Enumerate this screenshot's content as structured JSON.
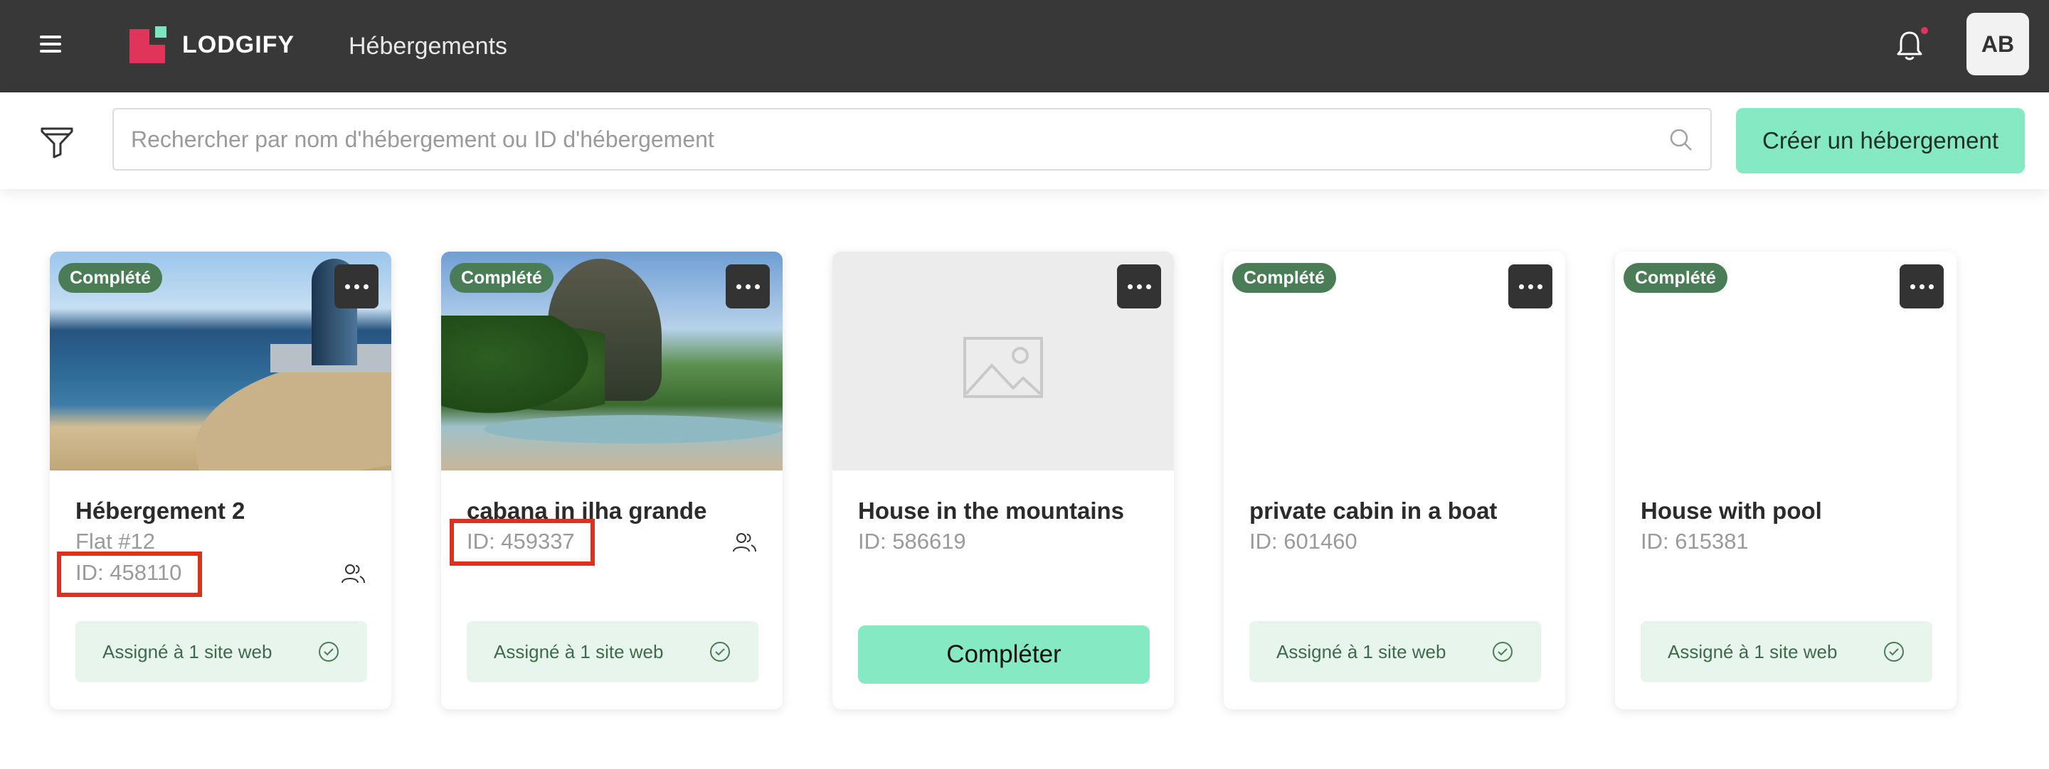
{
  "header": {
    "logo_text": "LODGIFY",
    "section_title": "Hébergements",
    "avatar_initials": "AB",
    "colors": {
      "bar": "#383838",
      "brand_red": "#e0345a",
      "brand_green": "#7fe3bf"
    }
  },
  "toolbar": {
    "search_placeholder": "Rechercher par nom d'hébergement ou ID d'hébergement",
    "create_label": "Créer un hébergement",
    "accent": "#85e9c3"
  },
  "cards": [
    {
      "badge": "Complété",
      "name": "Hébergement 2",
      "subtitle": "Flat #12",
      "id_text": "ID: 458110",
      "assigned_text": "Assigné à 1 site web",
      "image": "beach-photo"
    },
    {
      "badge": "Complété",
      "name": "cabana in ilha grande",
      "id_text": "ID: 459337",
      "assigned_text": "Assigné à 1 site web",
      "image": "tropical-photo"
    },
    {
      "name": "House in the mountains",
      "id_text": "ID: 586619",
      "action_label": "Compléter",
      "image": "placeholder"
    },
    {
      "badge": "Complété",
      "name": "private cabin in a boat",
      "id_text": "ID: 601460",
      "assigned_text": "Assigné à 1 site web",
      "image": "none"
    },
    {
      "badge": "Complété",
      "name": "House with pool",
      "id_text": "ID: 615381",
      "assigned_text": "Assigné à 1 site web",
      "image": "none"
    }
  ],
  "status_colors": {
    "badge": "#4a7c55",
    "assigned_bg": "#e8f5ec",
    "highlight": "#d9321f"
  }
}
